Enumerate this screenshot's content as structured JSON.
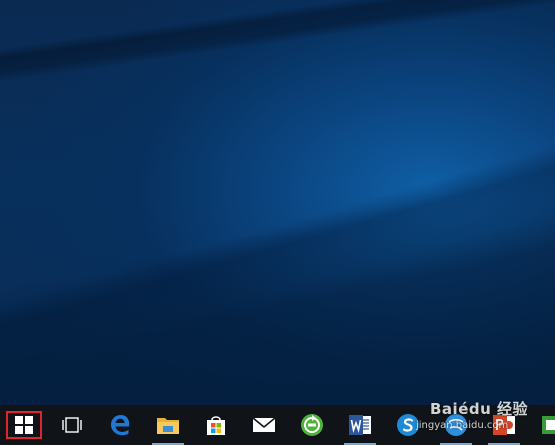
{
  "desktop": {
    "wallpaper": "windows-10-hero-blue"
  },
  "taskbar": {
    "items": [
      {
        "name": "start-button",
        "icon": "windows-logo-icon",
        "highlighted": true,
        "highlight_color": "#e0262c"
      },
      {
        "name": "task-view-button",
        "icon": "task-view-icon"
      },
      {
        "name": "taskbar-app-edge",
        "icon": "edge-icon",
        "color": "#1e78d4"
      },
      {
        "name": "taskbar-app-file-explorer",
        "icon": "folder-icon",
        "color": "#f6c244",
        "running": true
      },
      {
        "name": "taskbar-app-store",
        "icon": "store-bag-icon"
      },
      {
        "name": "taskbar-app-mail",
        "icon": "mail-icon"
      },
      {
        "name": "taskbar-app-green-refresh",
        "icon": "green-circle-arrow-icon",
        "color": "#4db33d"
      },
      {
        "name": "taskbar-app-word",
        "icon": "word-icon",
        "color": "#2b579a",
        "running": true
      },
      {
        "name": "taskbar-app-sogou",
        "icon": "blue-s-icon",
        "color": "#1e8ad6"
      },
      {
        "name": "taskbar-app-browser",
        "icon": "blue-globe-icon",
        "color": "#2f8fdc",
        "running": true
      },
      {
        "name": "taskbar-app-powerpoint",
        "icon": "powerpoint-icon",
        "color": "#d24726",
        "running": true
      },
      {
        "name": "taskbar-app-green",
        "icon": "green-app-icon",
        "color": "#3a9b3a"
      }
    ]
  },
  "watermark": {
    "text": "Baiédu 经验",
    "subtext": "jingyan.baidu.com"
  },
  "colors": {
    "taskbar": "#101418",
    "accent": "#0b4682"
  }
}
